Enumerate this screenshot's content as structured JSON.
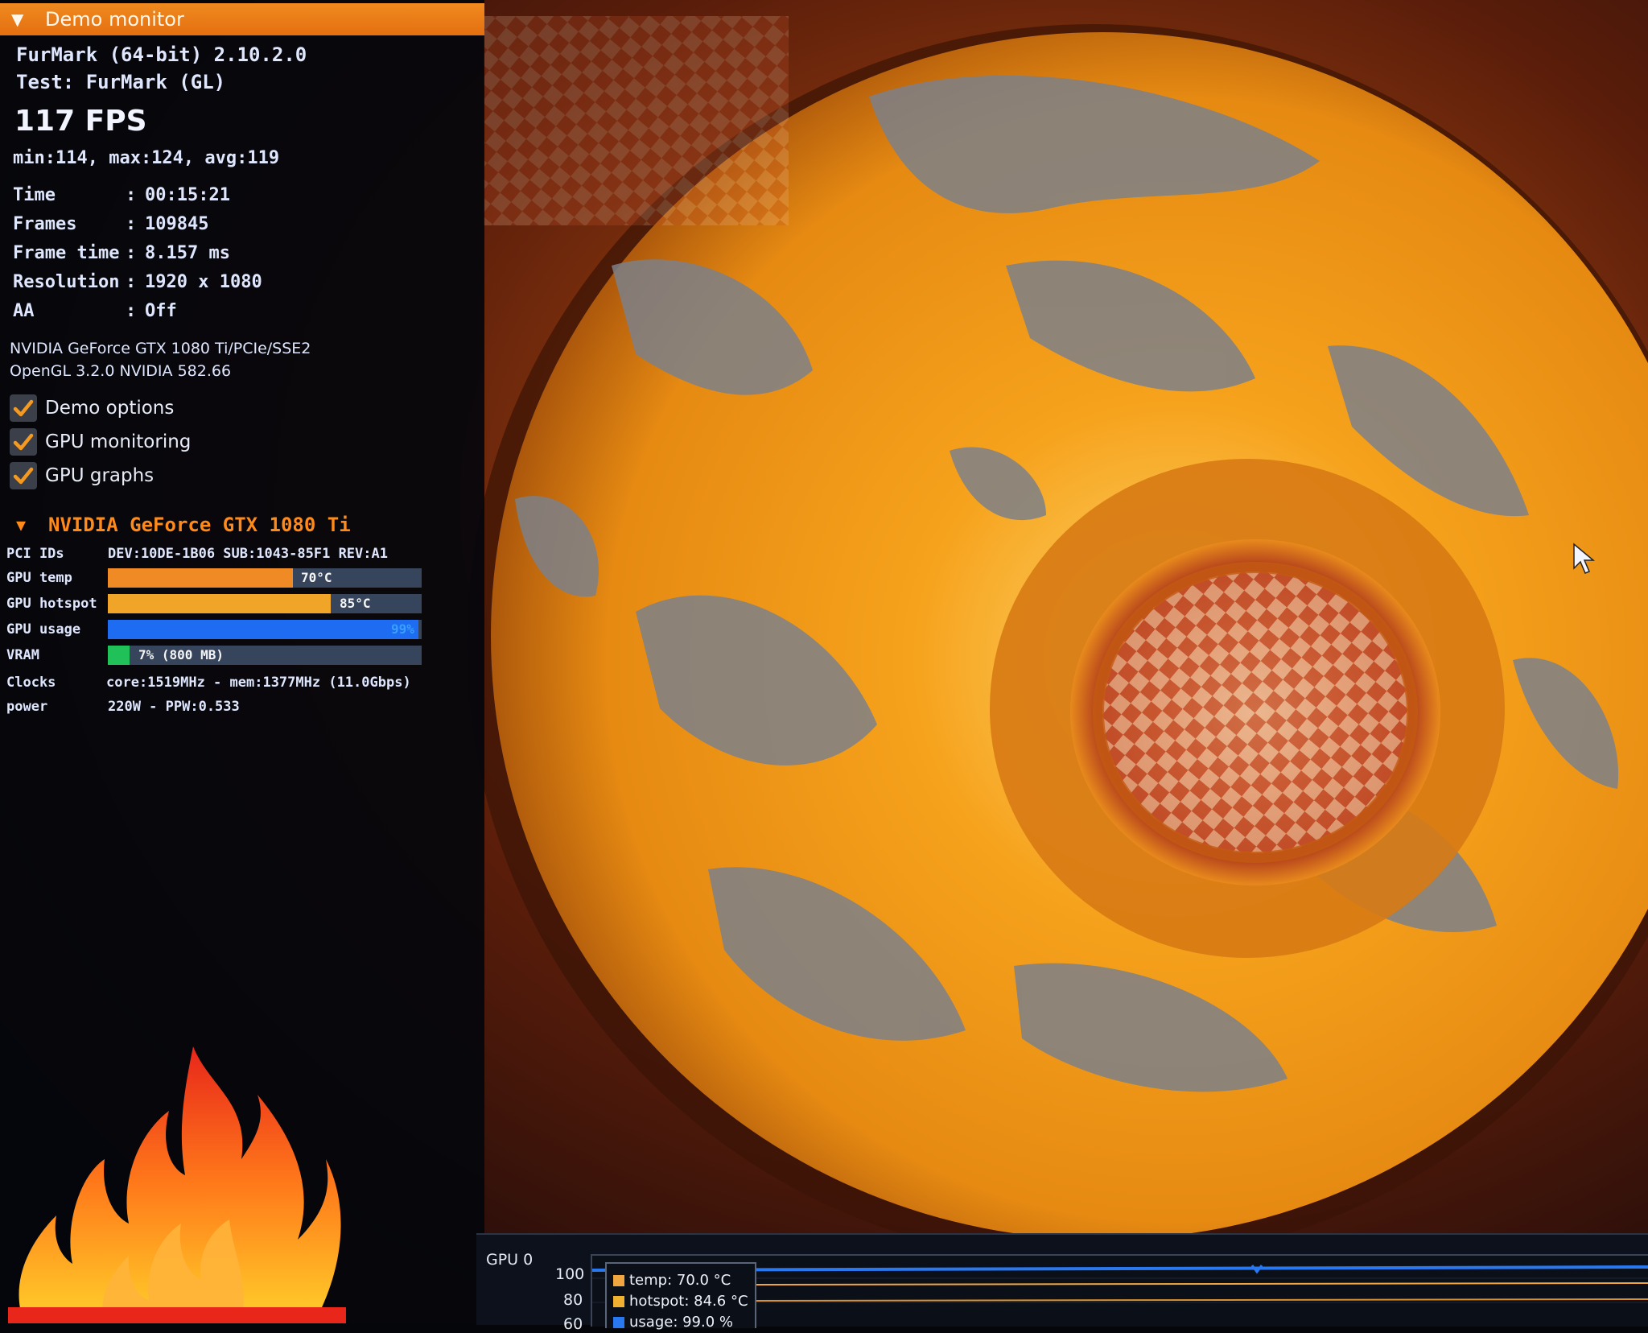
{
  "window": {
    "title": "Demo monitor"
  },
  "app": {
    "name_line": "FurMark (64-bit) 2.10.2.0",
    "test_line": "Test: FurMark (GL)"
  },
  "perf": {
    "fps": "117 FPS",
    "minmax": "min:114, max:124, avg:119",
    "stats": [
      {
        "label": "Time",
        "value": "00:15:21"
      },
      {
        "label": "Frames",
        "value": "109845"
      },
      {
        "label": "Frame time",
        "value": "8.157 ms"
      },
      {
        "label": "Resolution",
        "value": "1920 x 1080"
      },
      {
        "label": "AA",
        "value": "Off"
      }
    ]
  },
  "renderer": {
    "gpu_line": "NVIDIA GeForce GTX 1080 Ti/PCIe/SSE2",
    "gl_line": "OpenGL 3.2.0 NVIDIA 582.66"
  },
  "options": [
    {
      "label": "Demo options",
      "checked": true
    },
    {
      "label": "GPU monitoring",
      "checked": true
    },
    {
      "label": "GPU graphs",
      "checked": true
    }
  ],
  "gpu": {
    "name": "NVIDIA GeForce GTX 1080 Ti",
    "pci_label": "PCI IDs",
    "pci_value": "DEV:10DE-1B06 SUB:1043-85F1 REV:A1",
    "temp": {
      "label": "GPU temp",
      "value": "70°C",
      "fraction": 0.59,
      "color": "#f08a24"
    },
    "hotspot": {
      "label": "GPU hotspot",
      "value": "85°C",
      "fraction": 0.71,
      "color": "#f0a428"
    },
    "usage": {
      "label": "GPU usage",
      "value": "99%",
      "fraction": 0.99,
      "color": "#1d6cf2"
    },
    "vram": {
      "label": "VRAM",
      "value": "7% (800 MB)",
      "fraction": 0.07,
      "color": "#21c15a"
    },
    "clocks_label": "Clocks",
    "clocks_value": "core:1519MHz - mem:1377MHz (11.0Gbps)",
    "power_label": "power",
    "power_value": "220W - PPW:0.533"
  },
  "graph": {
    "title": "GPU 0",
    "y_ticks": [
      "100",
      "80",
      "60"
    ],
    "legend": [
      {
        "label": "temp: 70.0 °C",
        "color": "#f0a640"
      },
      {
        "label": "hotspot: 84.6 °C",
        "color": "#f0b030"
      },
      {
        "label": "usage: 99.0 %",
        "color": "#2a78f0"
      }
    ]
  },
  "icons": {
    "logo": "furmark-flame-logo",
    "cursor": "mouse-cursor-icon",
    "check": "check-icon"
  }
}
